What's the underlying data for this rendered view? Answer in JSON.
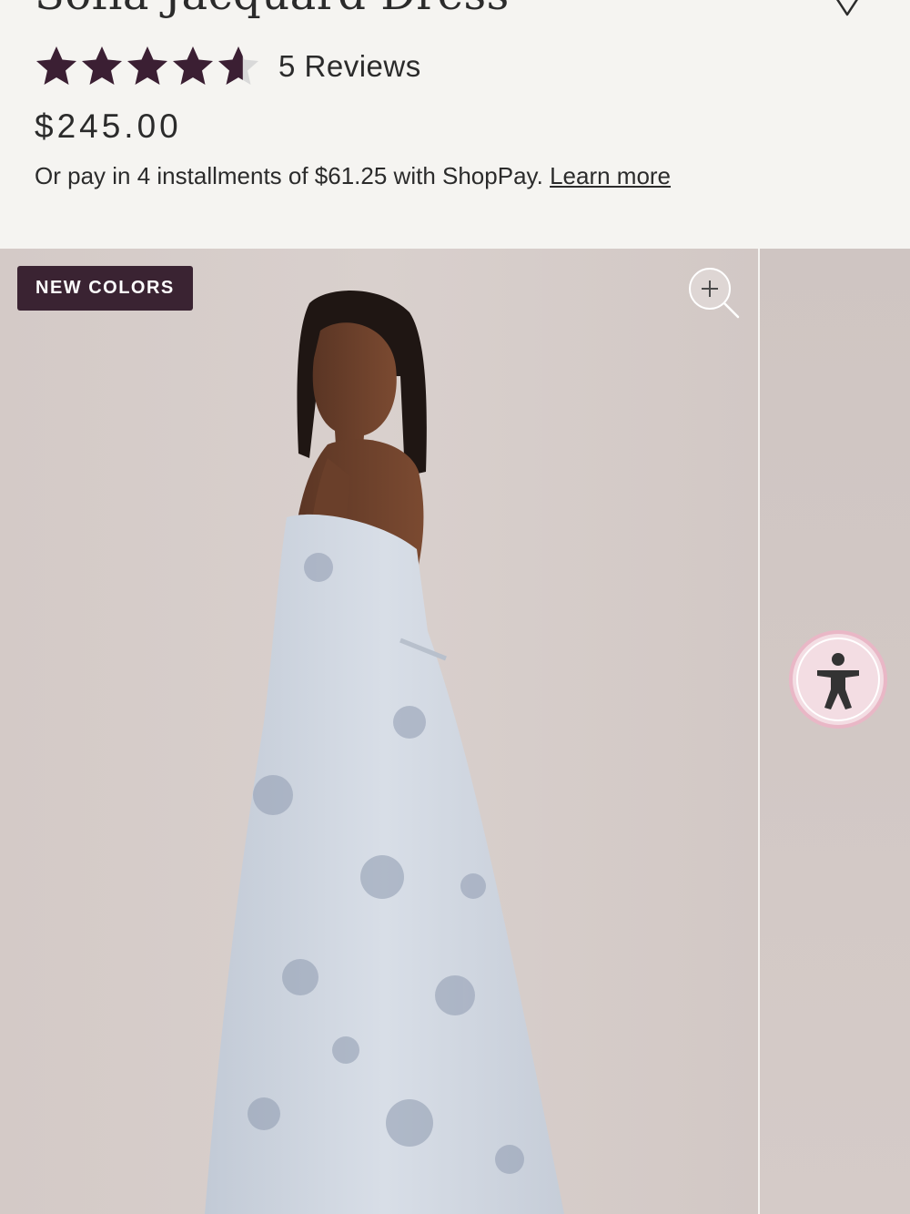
{
  "product": {
    "title": "Sofia Jacquard Dress",
    "rating": 4.6,
    "rating_max": 5,
    "reviews_label": "5 Reviews",
    "price": "$245.00",
    "installments_text": "Or pay in 4 installments of $61.25 with ShopPay.",
    "learn_more_label": "Learn more"
  },
  "gallery": {
    "badge_label": "NEW COLORS"
  },
  "colors": {
    "star_fill": "#3b1f33",
    "star_empty": "#d9d9d9",
    "badge_bg": "#3a2332",
    "page_bg": "#f5f4f1",
    "accessibility_ring": "#e9b7c6"
  },
  "icons": {
    "wishlist": "heart-icon",
    "zoom": "zoom-in-icon",
    "accessibility": "accessibility-icon",
    "star": "star-icon"
  }
}
